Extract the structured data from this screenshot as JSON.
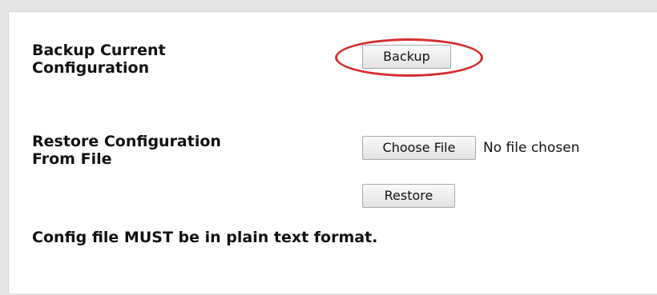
{
  "backup": {
    "label_line1": "Backup Current",
    "label_line2": "Configuration",
    "button_label": "Backup"
  },
  "restore": {
    "label_line1": "Restore Configuration",
    "label_line2": "From File",
    "choose_file_label": "Choose File",
    "file_status": "No file chosen",
    "button_label": "Restore"
  },
  "note": "Config file MUST be in plain text format.",
  "colors": {
    "highlight": "#d42c2c",
    "background": "#e4e4e4"
  }
}
